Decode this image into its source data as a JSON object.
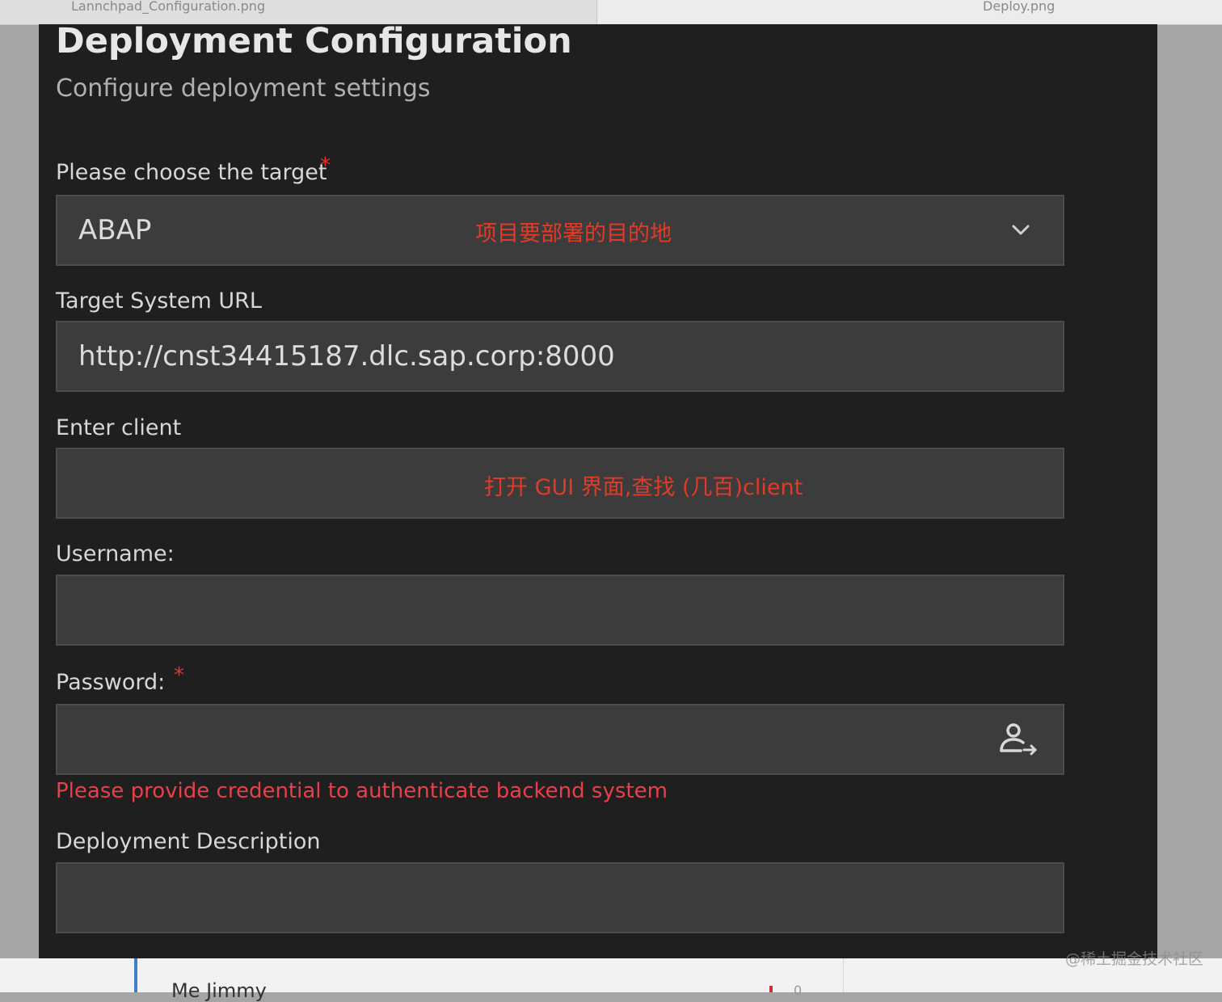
{
  "tabs": {
    "left": "Lannchpad_Configuration.png",
    "right": "Deploy.png"
  },
  "header": {
    "title": "Deployment Configuration",
    "subtitle": "Configure deployment settings"
  },
  "form": {
    "target": {
      "label": "Please choose the target",
      "required_mark": "*",
      "value": "ABAP",
      "annotation": "项目要部署的目的地",
      "icon": "chevron-down-icon"
    },
    "url": {
      "label": "Target System URL",
      "value": "http://cnst34415187.dlc.sap.corp:8000"
    },
    "client": {
      "label": "Enter client",
      "annotation": "打开 GUI 界面,查找 (几百)client"
    },
    "username": {
      "label": "Username:"
    },
    "password": {
      "label": "Password:",
      "required_mark": "*",
      "icon": "user-login-icon",
      "error": "Please provide credential to authenticate backend system"
    },
    "description": {
      "label": "Deployment Description"
    }
  },
  "bottom": {
    "text": "Me  Jimmy",
    "num": "0"
  },
  "watermark": "@稀土掘金技术社区",
  "colors": {
    "panel_bg": "#1f1f1f",
    "field_bg": "#3c3c3c",
    "annotation": "#e33a26",
    "error": "#e8404a",
    "required": "#e0352a"
  }
}
